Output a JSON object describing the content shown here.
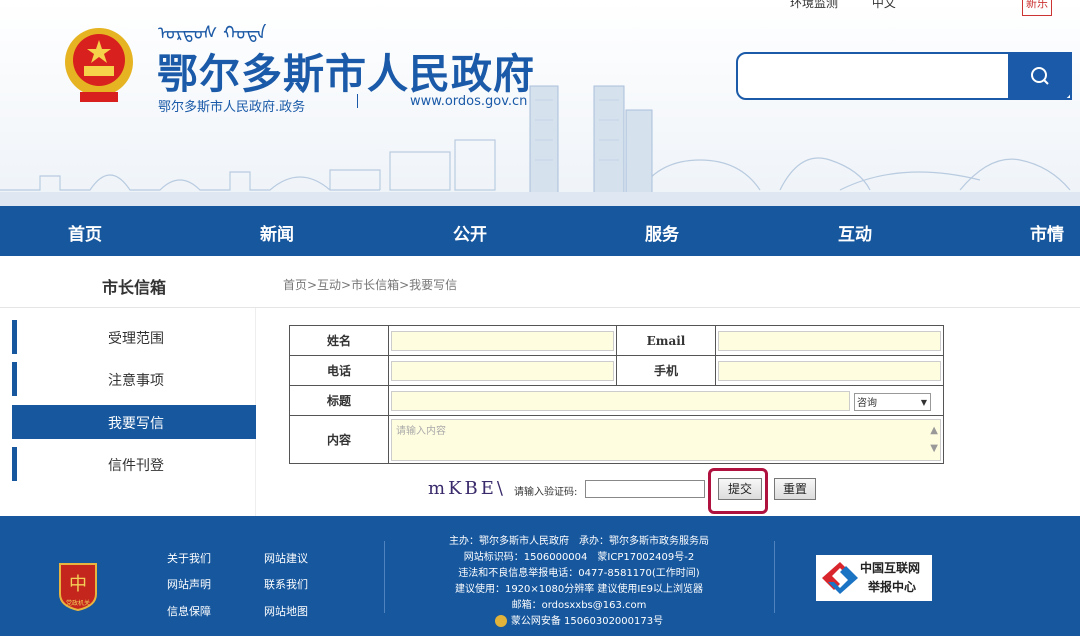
{
  "header": {
    "top_links": [
      "环境监测",
      "中文"
    ],
    "seal_text": "新乐",
    "mongolian_script": "ᠣᠷᠳᠣᠰ ᠬᠣᠲᠠ",
    "title": "鄂尔多斯市人民政府",
    "subtitle": "鄂尔多斯市人民政府.政务",
    "url": "www.ordos.gov.cn",
    "search": {
      "placeholder": ""
    }
  },
  "nav": {
    "items": [
      "首页",
      "新闻",
      "公开",
      "服务",
      "互动",
      "市情"
    ]
  },
  "sidebar": {
    "title": "市长信箱",
    "items": [
      {
        "label": "受理范围"
      },
      {
        "label": "注意事项"
      },
      {
        "label": "我要写信",
        "active": true
      },
      {
        "label": "信件刊登"
      }
    ]
  },
  "breadcrumb": "首页>互动>市长信箱>我要写信",
  "form": {
    "name_label": "姓名",
    "email_label": "Email",
    "phone_label": "电话",
    "mobile_label": "手机",
    "subject_label": "标题",
    "category_value": "咨询",
    "content_label": "内容",
    "content_placeholder": "请输入内容",
    "captcha_text": "mKBE\\",
    "captcha_label": "请输入验证码:",
    "submit_label": "提交",
    "reset_label": "重置"
  },
  "footer": {
    "logo_text": "党政机关",
    "links": [
      "关于我们",
      "网站建议",
      "网站声明",
      "联系我们",
      "信息保障",
      "网站地图"
    ],
    "info": [
      "主办：鄂尔多斯市人民政府　承办：鄂尔多斯市政务服务局",
      "网站标识码：1506000004　蒙ICP17002409号-2",
      "违法和不良信息举报电话：0477-8581170(工作时间)",
      "建议使用：1920×1080分辨率 建议使用IE9以上浏览器",
      "邮箱：ordosxxbs@163.com",
      "蒙公网安备 15060302000173号"
    ],
    "report": [
      "中国互联网",
      "举报中心"
    ]
  },
  "colors": {
    "primary": "#16579e",
    "highlight": "#b0123f",
    "field_bg": "#fffde0"
  }
}
